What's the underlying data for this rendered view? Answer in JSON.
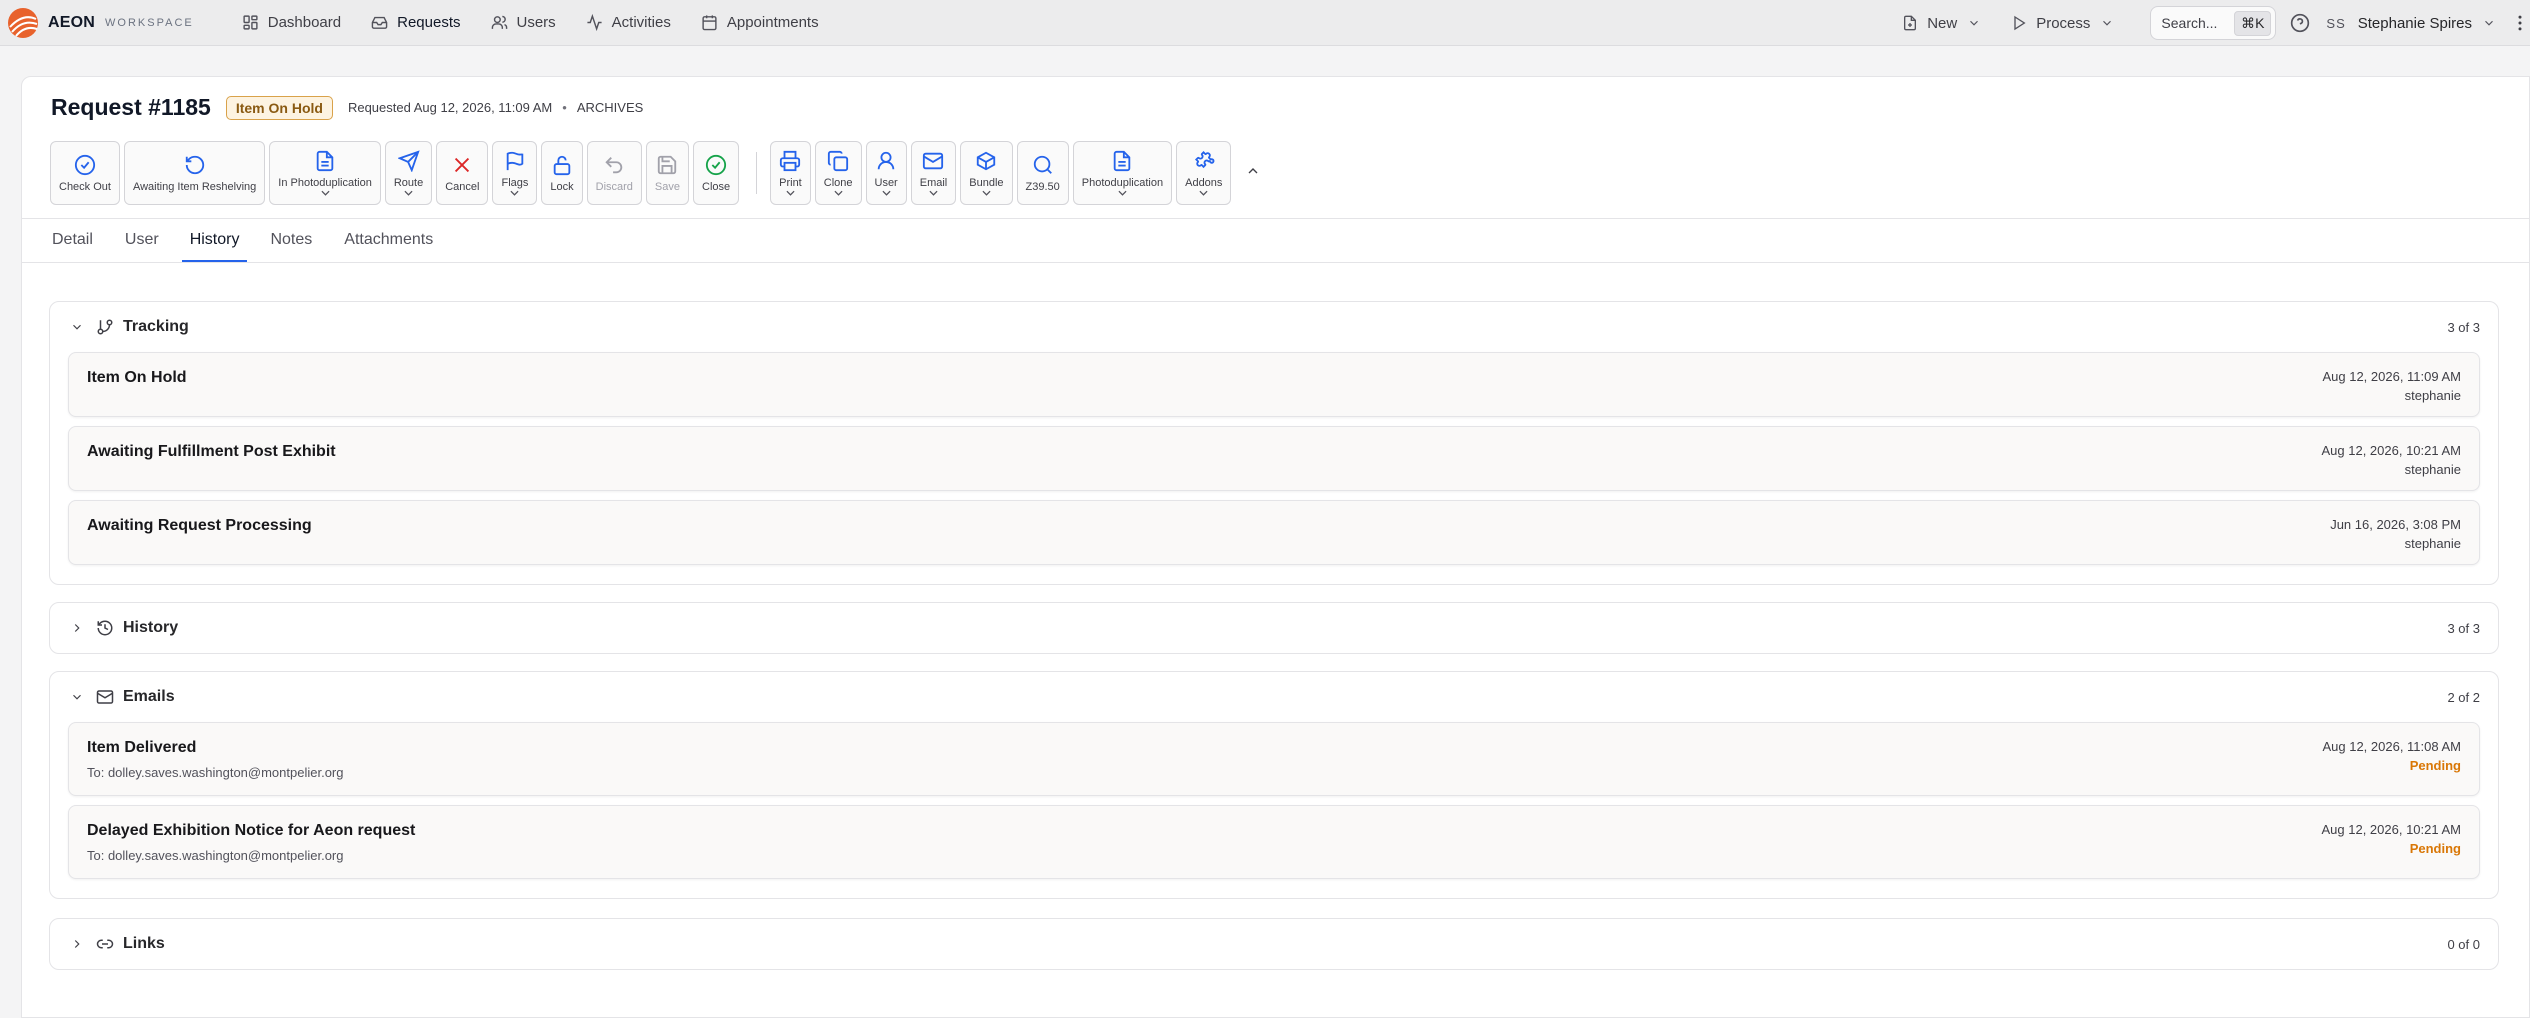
{
  "app": {
    "name": "AEON",
    "sub": "WORKSPACE"
  },
  "nav": {
    "items": [
      {
        "label": "Dashboard",
        "icon": "dashboard-icon"
      },
      {
        "label": "Requests",
        "icon": "inbox-icon"
      },
      {
        "label": "Users",
        "icon": "users-icon"
      },
      {
        "label": "Activities",
        "icon": "activity-icon"
      },
      {
        "label": "Appointments",
        "icon": "calendar-icon"
      }
    ],
    "new_label": "New",
    "process_label": "Process",
    "search_placeholder": "Search...",
    "search_shortcut": "⌘K",
    "user_initials": "SS",
    "user_name": "Stephanie Spires"
  },
  "request": {
    "title": "Request #1185",
    "status": "Item On Hold",
    "requested": "Requested Aug 12, 2026, 11:09 AM",
    "separator": "•",
    "site": "ARCHIVES"
  },
  "toolbar": {
    "check_out": "Check Out",
    "awaiting_reshelving": "Awaiting Item Reshelving",
    "in_photoduplication": "In Photoduplication",
    "route": "Route",
    "cancel": "Cancel",
    "flags": "Flags",
    "lock": "Lock",
    "discard": "Discard",
    "save": "Save",
    "close": "Close",
    "print": "Print",
    "clone": "Clone",
    "user": "User",
    "email": "Email",
    "bundle": "Bundle",
    "z3950": "Z39.50",
    "photoduplication": "Photoduplication",
    "addons": "Addons"
  },
  "tabs": [
    "Detail",
    "User",
    "History",
    "Notes",
    "Attachments"
  ],
  "tracking": {
    "title": "Tracking",
    "count": "3 of 3",
    "rows": [
      {
        "title": "Item On Hold",
        "date": "Aug 12, 2026, 11:09 AM",
        "by": "stephanie"
      },
      {
        "title": "Awaiting Fulfillment Post Exhibit",
        "date": "Aug 12, 2026, 10:21 AM",
        "by": "stephanie"
      },
      {
        "title": "Awaiting Request Processing",
        "date": "Jun 16, 2026, 3:08 PM",
        "by": "stephanie"
      }
    ]
  },
  "history": {
    "title": "History",
    "count": "3 of 3"
  },
  "emails": {
    "title": "Emails",
    "count": "2 of 2",
    "rows": [
      {
        "title": "Item Delivered",
        "to": "To: dolley.saves.washington@montpelier.org",
        "date": "Aug 12, 2026, 11:08 AM",
        "status": "Pending"
      },
      {
        "title": "Delayed Exhibition Notice for Aeon request",
        "to": "To: dolley.saves.washington@montpelier.org",
        "date": "Aug 12, 2026, 10:21 AM",
        "status": "Pending"
      }
    ]
  },
  "links": {
    "title": "Links",
    "count": "0 of 0"
  },
  "colors": {
    "accent": "#2563eb",
    "status_badge": "#fdf3e1",
    "pending": "#d97706",
    "cancel": "#dc2626",
    "close": "#16a34a"
  }
}
